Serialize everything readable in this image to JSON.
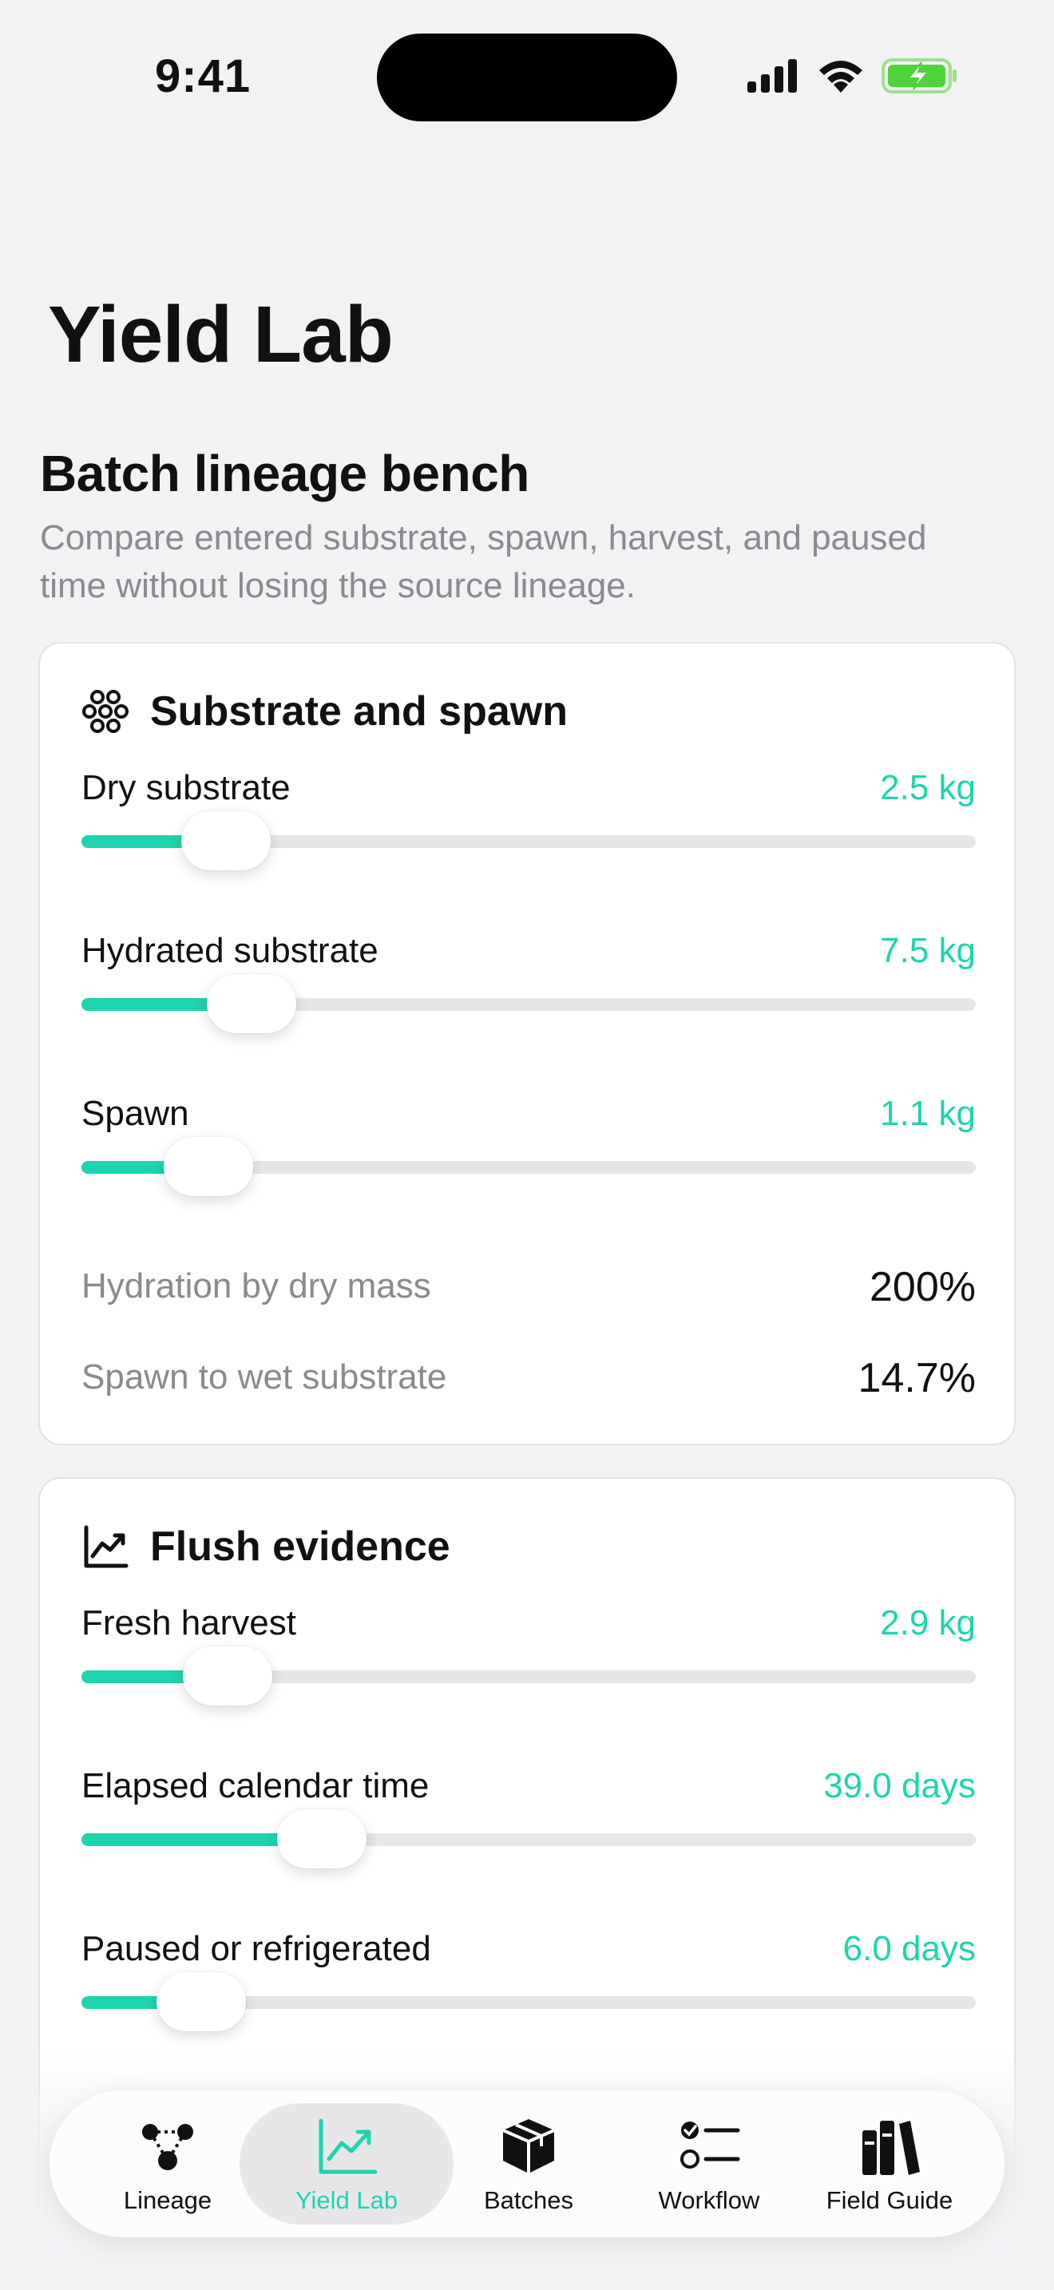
{
  "status": {
    "time": "9:41"
  },
  "page": {
    "title": "Yield Lab",
    "section_title": "Batch lineage bench",
    "section_subtitle": "Compare entered substrate, spawn, harvest, and paused time without losing the source lineage."
  },
  "substrate_card": {
    "title": "Substrate and spawn",
    "sliders": [
      {
        "label": "Dry substrate",
        "value": "2.5 kg",
        "fraction": 0.135
      },
      {
        "label": "Hydrated substrate",
        "value": "7.5 kg",
        "fraction": 0.163
      },
      {
        "label": "Spawn",
        "value": "1.1 kg",
        "fraction": 0.115
      }
    ],
    "stats": [
      {
        "label": "Hydration by dry mass",
        "value": "200%"
      },
      {
        "label": "Spawn to wet substrate",
        "value": "14.7%"
      }
    ]
  },
  "flush_card": {
    "title": "Flush evidence",
    "sliders": [
      {
        "label": "Fresh harvest",
        "value": "2.9 kg",
        "fraction": 0.137
      },
      {
        "label": "Elapsed calendar time",
        "value": "39.0 days",
        "fraction": 0.242
      },
      {
        "label": "Paused or refrigerated",
        "value": "6.0 days",
        "fraction": 0.107
      }
    ]
  },
  "tabbar": {
    "tabs": [
      {
        "label": "Lineage",
        "icon": "lineage-graph-icon",
        "active": false
      },
      {
        "label": "Yield Lab",
        "icon": "chart-trend-icon",
        "active": true
      },
      {
        "label": "Batches",
        "icon": "box-icon",
        "active": false
      },
      {
        "label": "Workflow",
        "icon": "checklist-icon",
        "active": false
      },
      {
        "label": "Field Guide",
        "icon": "books-icon",
        "active": false
      }
    ]
  },
  "colors": {
    "accent": "#1ed4ae",
    "background": "#f2f2f5",
    "secondary_text": "#8a8a8e"
  }
}
